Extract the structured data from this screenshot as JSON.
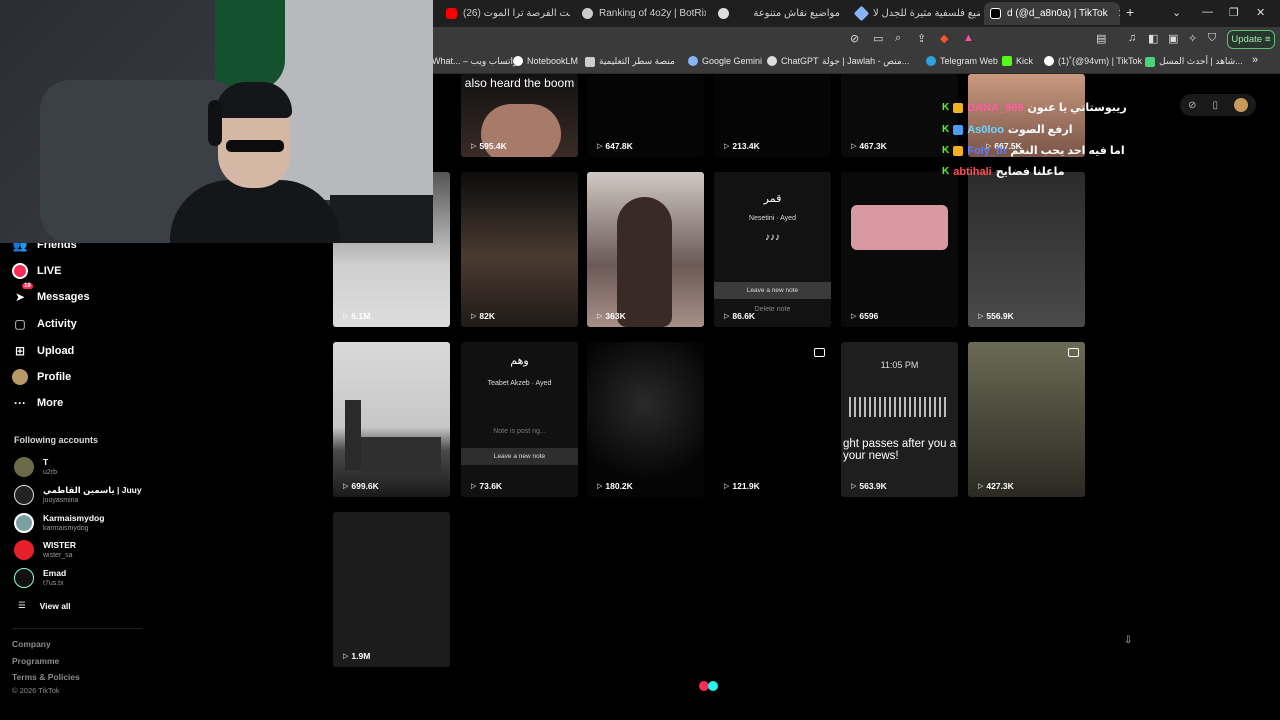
{
  "browser": {
    "tabs": [
      {
        "label": "(26) لا ضاعت الفرصة ترا الموت...",
        "icon": "youtube-icon",
        "color": "#ff0000"
      },
      {
        "label": "Ranking of 4o2y | BotRix — C",
        "icon": "botrix-icon",
        "color": "#cccccc"
      },
      {
        "label": "مواضيع نقاش متنوعة",
        "icon": "chatgpt-icon",
        "color": "#dddddd"
      },
      {
        "label": "مواضيع فلسفية مثيرة للجدل لا",
        "icon": "gemini-icon",
        "color": "#8ab4f8"
      },
      {
        "label": "d (@d_a8n0a) | TikTok",
        "icon": "tiktok-icon",
        "color": "#ffffff"
      }
    ],
    "new_tab": "+",
    "update_label": "Update",
    "bookmarks": [
      {
        "label": "What... – واتساب ويب",
        "color": "#25d366"
      },
      {
        "label": "NotebookLM",
        "color": "#ffffff"
      },
      {
        "label": "منصة سطر التعليمية",
        "color": "#cccccc"
      },
      {
        "label": "Google Gemini",
        "color": "#8ab4f8"
      },
      {
        "label": "ChatGPT",
        "color": "#ffffff"
      },
      {
        "label": "جولة | Jawlah - منص...",
        "color": "#dddddd"
      },
      {
        "label": "Telegram Web",
        "color": "#2aa3e0"
      },
      {
        "label": "Kick",
        "color": "#53fc18"
      },
      {
        "label": "(1)˚(@94vm) | TikTok",
        "color": "#ffffff"
      },
      {
        "label": "شاهد | أحدث المسل...",
        "color": "#49d17d"
      }
    ],
    "more_bookmarks": "»"
  },
  "sidebar": {
    "items": [
      {
        "label": "Friends",
        "icon": "friends-icon"
      },
      {
        "label": "LIVE",
        "icon": "live-icon"
      },
      {
        "label": "Messages",
        "icon": "messages-icon",
        "badge": "19"
      },
      {
        "label": "Activity",
        "icon": "activity-icon"
      },
      {
        "label": "Upload",
        "icon": "upload-icon"
      },
      {
        "label": "Profile",
        "icon": "profile-icon"
      },
      {
        "label": "More",
        "icon": "more-icon"
      }
    ],
    "following_heading": "Following accounts",
    "accounts": [
      {
        "name": "T",
        "username": "u2rb",
        "color": "#6b6b4a"
      },
      {
        "name": "ياسمين القاطمي | Juuy",
        "username": "juuyasmina",
        "color": "#ffffff"
      },
      {
        "name": "Karmaismydog",
        "username": "karmaismydog",
        "color": "#7aa0a0"
      },
      {
        "name": "WISTER",
        "username": "wister_sa",
        "color": "#e5202c"
      },
      {
        "name": "Emad",
        "username": "t7us.tx",
        "color": "#111111"
      }
    ],
    "view_all": "View all",
    "footer": [
      "Company",
      "Programme",
      "Terms & Policies"
    ],
    "copyright": "© 2026 TikTok"
  },
  "videos": [
    {
      "views": "595.4K",
      "caption": "also heard the boom"
    },
    {
      "views": "647.8K"
    },
    {
      "views": "213.4K"
    },
    {
      "views": "467.3K"
    },
    {
      "views": "667.5K"
    },
    {
      "views": "6.1M"
    },
    {
      "views": "82K"
    },
    {
      "views": "363K"
    },
    {
      "views": "86.6K",
      "title": "قمر",
      "song": "Nesetini · Ayed",
      "note_btn": "Leave a new note",
      "delete": "Delete note"
    },
    {
      "views": "6596"
    },
    {
      "views": "556.9K"
    },
    {
      "views": "699.6K"
    },
    {
      "views": "73.6K",
      "title": "وهم",
      "song": "Teabet Akzeb · Ayed",
      "note_btn": "Leave a new note",
      "note_sub": "Note is post ng..."
    },
    {
      "views": "180.2K"
    },
    {
      "views": "121.9K"
    },
    {
      "views": "563.9K",
      "time": "11:05 PM",
      "caption": "ght passes after you a your news!"
    },
    {
      "views": "427.3K"
    },
    {
      "views": "1.9M"
    }
  ],
  "chat": [
    {
      "user": "DANA_909",
      "msg": "ريبوستاتي يا عنون",
      "user_color": "#ff5fa0"
    },
    {
      "user": "As0loo",
      "msg": "ارفع الصوت",
      "user_color": "#6fd3ff"
    },
    {
      "user": "Foly_th",
      "msg": "اما فيه احد يحب النغم",
      "user_color": "#5b7bff"
    },
    {
      "user": "abtihali",
      "msg": "ماعلنا فضايح",
      "user_color": "#ff4f4f"
    }
  ]
}
